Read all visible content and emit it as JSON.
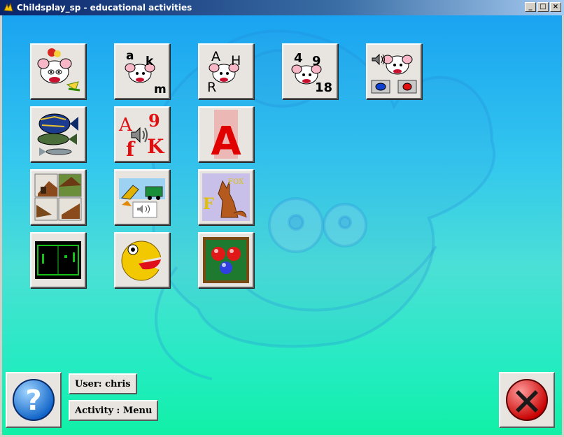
{
  "window": {
    "title": "Childsplay_sp - educational activities",
    "controls": {
      "minimize": "_",
      "maximize": "□",
      "close": "×"
    }
  },
  "activities": [
    {
      "id": "memory-fruit",
      "icon": "brain-mouse-fruit-icon"
    },
    {
      "id": "letters-lowercase",
      "icon": "letters-akm-icon",
      "letters": [
        "a",
        "k",
        "m"
      ]
    },
    {
      "id": "letters-uppercase",
      "icon": "letters-AHR-icon",
      "letters": [
        "A",
        "H",
        "R"
      ]
    },
    {
      "id": "numbers",
      "icon": "numbers-4-9-18-icon",
      "numbers": [
        "4",
        "9",
        "18"
      ]
    },
    {
      "id": "sound-memory",
      "icon": "brain-mouse-sound-icon"
    },
    {
      "id": "fish",
      "icon": "fish-icon"
    },
    {
      "id": "sound-letters",
      "icon": "sound-letters-icon",
      "letters": [
        "A",
        "9",
        "f",
        "K"
      ]
    },
    {
      "id": "big-letter",
      "icon": "big-letter-A-icon",
      "letters": [
        "A"
      ]
    },
    {
      "id": "puzzle",
      "icon": "puzzle-house-icon"
    },
    {
      "id": "sound-pictures",
      "icon": "sound-pictures-icon"
    },
    {
      "id": "fox-word",
      "icon": "fox-word-icon",
      "letters": [
        "FOX",
        "F"
      ]
    },
    {
      "id": "pong",
      "icon": "pong-icon"
    },
    {
      "id": "pacman",
      "icon": "pacman-icon"
    },
    {
      "id": "billiard",
      "icon": "billiard-balls-icon"
    }
  ],
  "status": {
    "user_label": "User: chris",
    "activity_label": "Activity : Menu"
  },
  "buttons": {
    "help_icon": "question-mark-icon",
    "quit_icon": "red-x-icon"
  },
  "colors": {
    "background_top": "#1aa3f1",
    "background_bottom": "#11f0a6",
    "tile_face": "#e8e5e0"
  }
}
